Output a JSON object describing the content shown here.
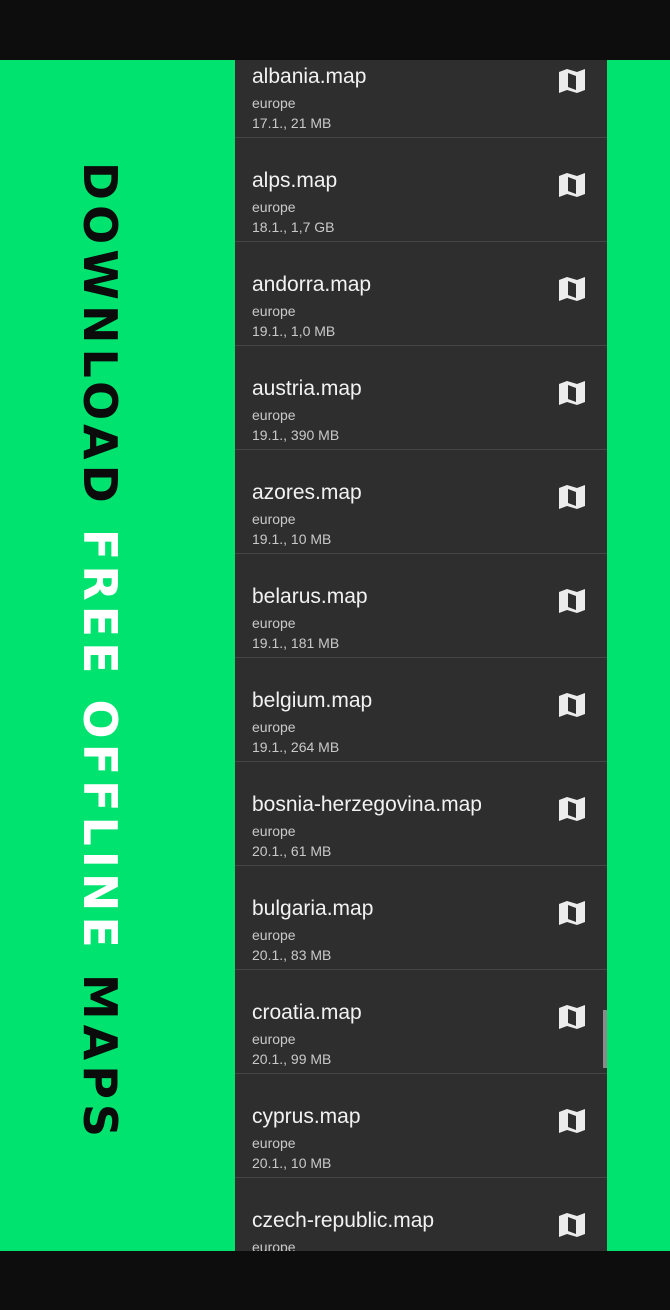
{
  "banner": {
    "part1": "DOWNLOAD",
    "part2": "FREE OFFLINE",
    "part3": "MAPS"
  },
  "maps": [
    {
      "name": "albania.map",
      "region": "europe",
      "meta": "17.1., 21 MB",
      "icon": "map-icon"
    },
    {
      "name": "alps.map",
      "region": "europe",
      "meta": "18.1., 1,7 GB",
      "icon": "map-icon"
    },
    {
      "name": "andorra.map",
      "region": "europe",
      "meta": "19.1., 1,0 MB",
      "icon": "map-icon"
    },
    {
      "name": "austria.map",
      "region": "europe",
      "meta": "19.1., 390 MB",
      "icon": "map-icon"
    },
    {
      "name": "azores.map",
      "region": "europe",
      "meta": "19.1., 10 MB",
      "icon": "map-icon"
    },
    {
      "name": "belarus.map",
      "region": "europe",
      "meta": "19.1., 181 MB",
      "icon": "map-icon"
    },
    {
      "name": "belgium.map",
      "region": "europe",
      "meta": "19.1., 264 MB",
      "icon": "map-icon"
    },
    {
      "name": "bosnia-herzegovina.map",
      "region": "europe",
      "meta": "20.1., 61 MB",
      "icon": "map-icon"
    },
    {
      "name": "bulgaria.map",
      "region": "europe",
      "meta": "20.1., 83 MB",
      "icon": "map-icon"
    },
    {
      "name": "croatia.map",
      "region": "europe",
      "meta": "20.1., 99 MB",
      "icon": "map-icon"
    },
    {
      "name": "cyprus.map",
      "region": "europe",
      "meta": "20.1., 10 MB",
      "icon": "map-icon"
    },
    {
      "name": "czech-republic.map",
      "region": "europe",
      "meta": "",
      "icon": "map-icon"
    }
  ],
  "colors": {
    "accent": "#00e36f",
    "list_background": "#2e2e2e",
    "divider": "#454545"
  }
}
